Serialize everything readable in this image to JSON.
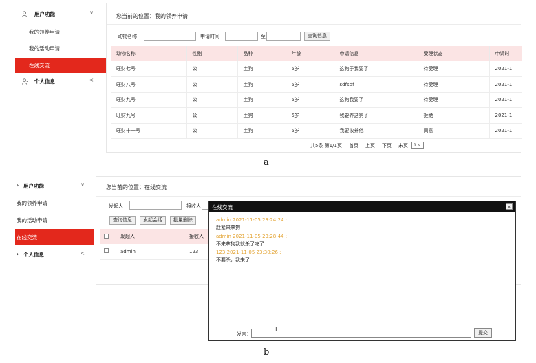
{
  "sidebar": {
    "user_functions": "用户功能",
    "my_adoptions": "我的领养申请",
    "my_activities": "我的活动申请",
    "online_chat": "在线交流",
    "personal_info": "个人信息"
  },
  "panel_a": {
    "location": "您当前的位置：我的领养申请",
    "search": {
      "animal_name_label": "动物名称",
      "apply_time_label": "申请时间",
      "to_label": "至",
      "query_button": "查询信息"
    },
    "table": {
      "headers": [
        "动物名称",
        "性别",
        "品种",
        "年龄",
        "申请信息",
        "受理状态",
        "申请时"
      ],
      "rows": [
        [
          "旺财七号",
          "公",
          "土狗",
          "5岁",
          "这狗子我要了",
          "待受理",
          "2021-1"
        ],
        [
          "旺财八号",
          "公",
          "土狗",
          "5岁",
          "sdfsdf",
          "待受理",
          "2021-1"
        ],
        [
          "旺财九号",
          "公",
          "土狗",
          "5岁",
          "这狗我要了",
          "待受理",
          "2021-1"
        ],
        [
          "旺财九号",
          "公",
          "土狗",
          "5岁",
          "我要养这狗子",
          "拒绝",
          "2021-1"
        ],
        [
          "旺财十一号",
          "公",
          "土狗",
          "5岁",
          "我要收养他",
          "同意",
          "2021-1"
        ]
      ]
    },
    "pager": {
      "summary": "共5条  第1/1页",
      "first": "首页",
      "prev": "上页",
      "next": "下页",
      "last": "末页",
      "select": "1"
    },
    "caption": "a"
  },
  "panel_b": {
    "location": "您当前的位置：在线交流",
    "sender_label": "发起人",
    "receiver_label": "接收人",
    "query_button": "查询信息",
    "start_chat_button": "发起会话",
    "batch_delete_button": "批量删除",
    "table": {
      "headers": [
        "发起人",
        "接收人"
      ],
      "rows": [
        [
          "admin",
          "123"
        ]
      ]
    },
    "chat": {
      "title": "在线交流",
      "close": "×",
      "messages": [
        {
          "meta": "admin   2021-11-05 23:24:24 :",
          "text": "赶紧来拿狗"
        },
        {
          "meta": "admin   2021-11-05 23:28:44 :",
          "text": "不来拿狗我就杀了吃了"
        },
        {
          "meta": "123   2021-11-05 23:30:26 :",
          "text": "不要杀，我来了"
        }
      ],
      "send_label": "发言：",
      "send_button": "提交"
    },
    "caption": "b"
  },
  "colors": {
    "accent": "#e3281c",
    "table_header": "#fbe4e4",
    "chat_meta": "#e3a332"
  }
}
